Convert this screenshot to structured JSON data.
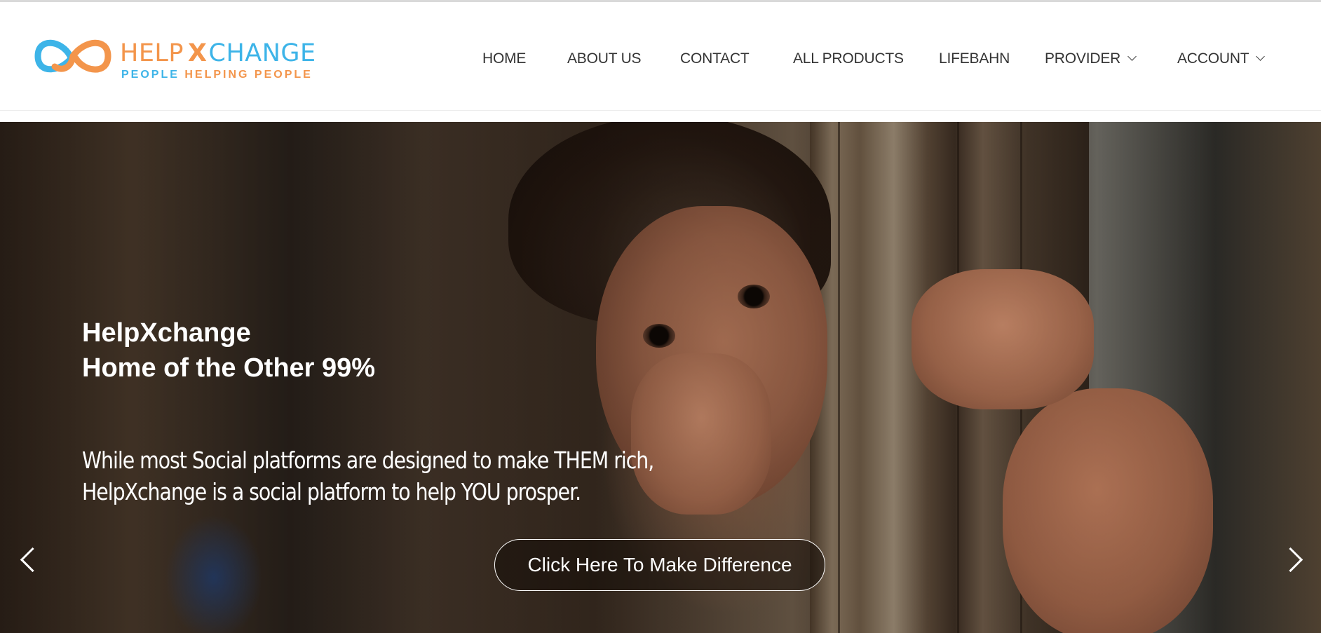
{
  "header": {
    "logo": {
      "word_left": "HELP",
      "word_x": "X",
      "word_right": "CHANGE",
      "tag_left": "PEOPLE",
      "tag_right": "HELPING PEOPLE",
      "colors": {
        "orange": "#f3954b",
        "blue": "#3db4e8"
      }
    },
    "nav": [
      {
        "label": "HOME"
      },
      {
        "label": "ABOUT US"
      },
      {
        "label": "CONTACT"
      },
      {
        "label": "ALL PRODUCTS"
      },
      {
        "label": "LIFEBAHN"
      },
      {
        "label": "PROVIDER",
        "icon": "chevron-down-icon"
      },
      {
        "label": "ACCOUNT",
        "icon": "chevron-down-icon"
      }
    ]
  },
  "hero": {
    "title_line1": "HelpXchange",
    "title_line2": "Home of the Other 99%",
    "subtitle_line1": "While most Social platforms are designed to make THEM rich,",
    "subtitle_line2": "HelpXchange is a social platform to help YOU prosper.",
    "cta_label": "Click Here To Make Difference",
    "prev_icon": "chevron-left-icon",
    "next_icon": "chevron-right-icon"
  }
}
